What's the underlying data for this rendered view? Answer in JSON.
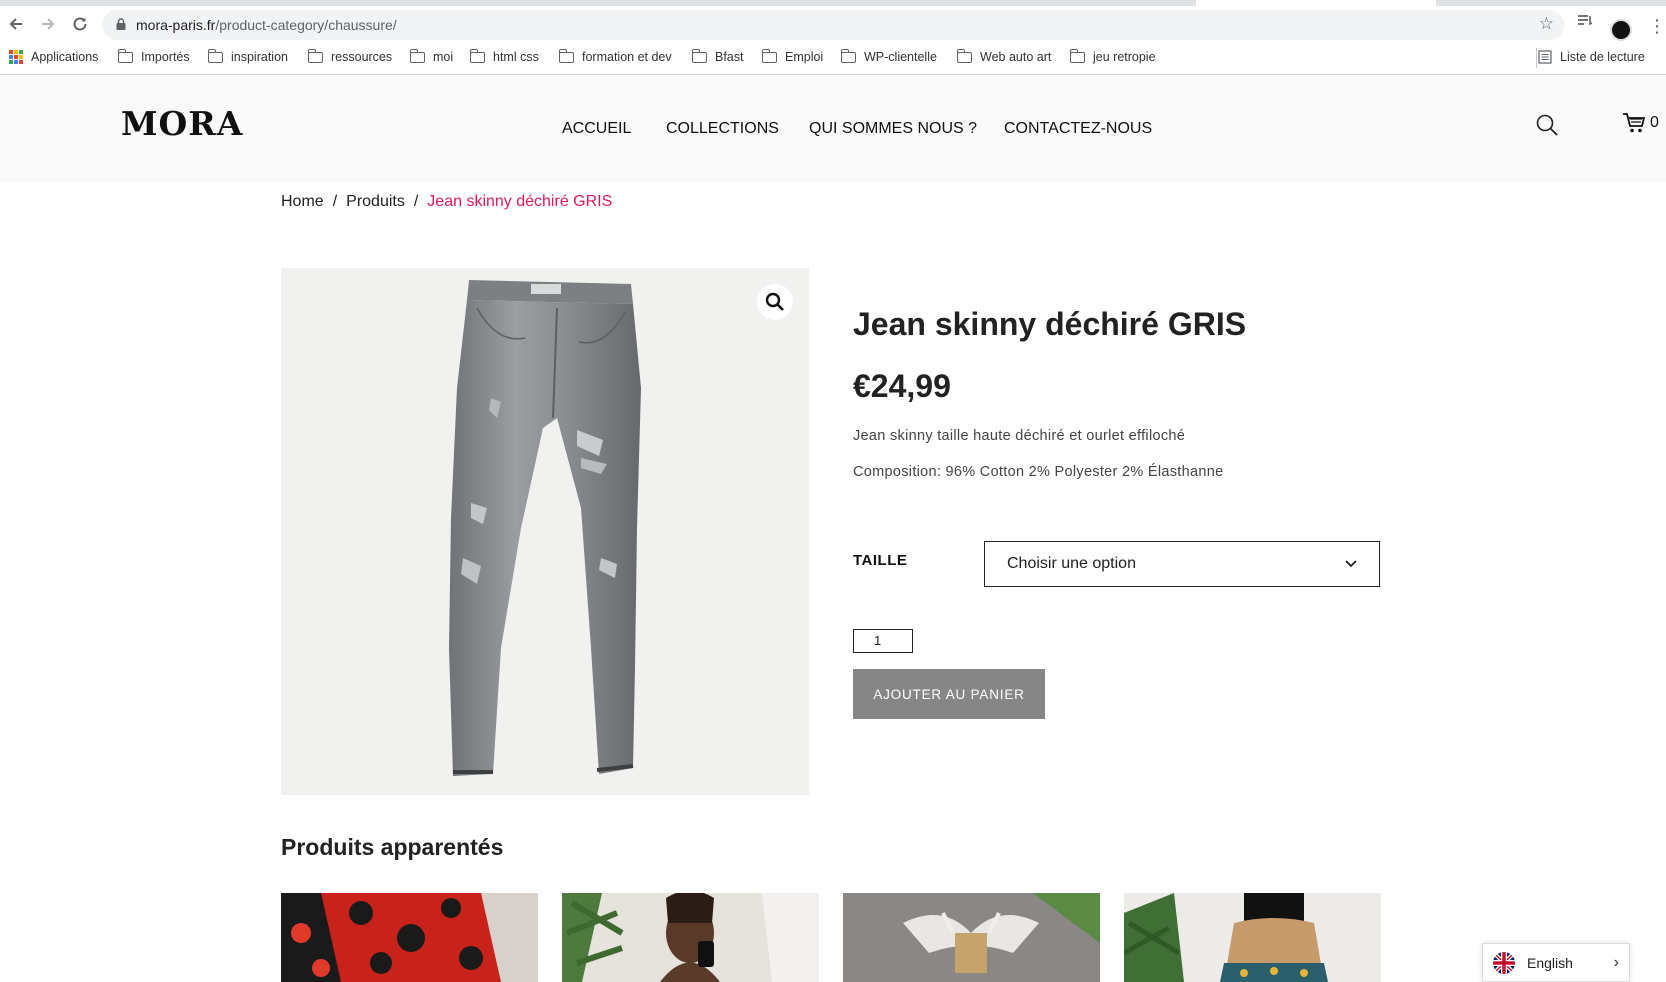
{
  "browser": {
    "url_domain": "mora-paris.fr",
    "url_path": "/product-category/chaussure/",
    "bookmarks": [
      {
        "label": "Applications",
        "icon": "apps-icon"
      },
      {
        "label": "Importés",
        "icon": "folder-icon"
      },
      {
        "label": "inspiration",
        "icon": "folder-icon"
      },
      {
        "label": "ressources",
        "icon": "folder-icon"
      },
      {
        "label": "moi",
        "icon": "folder-icon"
      },
      {
        "label": "html css",
        "icon": "folder-icon"
      },
      {
        "label": "formation et dev",
        "icon": "folder-icon"
      },
      {
        "label": "Bfast",
        "icon": "folder-icon"
      },
      {
        "label": "Emploi",
        "icon": "folder-icon"
      },
      {
        "label": "WP-clientelle",
        "icon": "folder-icon"
      },
      {
        "label": "Web auto art",
        "icon": "folder-icon"
      },
      {
        "label": "jeu retropie",
        "icon": "folder-icon"
      }
    ],
    "reading_list": "Liste de lecture"
  },
  "site": {
    "logo": "MORA",
    "nav": [
      "ACCUEIL",
      "COLLECTIONS",
      "QUI SOMMES NOUS ?",
      "CONTACTEZ-NOUS"
    ],
    "cart_count": "0"
  },
  "breadcrumb": {
    "items": [
      "Home",
      "Produits"
    ],
    "separator": "/",
    "current": "Jean skinny déchiré GRIS"
  },
  "product": {
    "title": "Jean skinny déchiré GRIS",
    "price": "€24,99",
    "description": [
      "Jean skinny taille haute déchiré et ourlet effiloché",
      "Composition: 96% Cotton 2% Polyester 2% Élasthanne"
    ],
    "size_label": "TAILLE",
    "size_select": "Choisir une option",
    "quantity": "1",
    "add_to_cart": "AJOUTER AU PANIER"
  },
  "related": {
    "title": "Produits apparentés"
  },
  "language": {
    "label": "English"
  },
  "colors": {
    "accent": "#e0195d",
    "button": "#868686",
    "header_bg": "#fafafa"
  }
}
